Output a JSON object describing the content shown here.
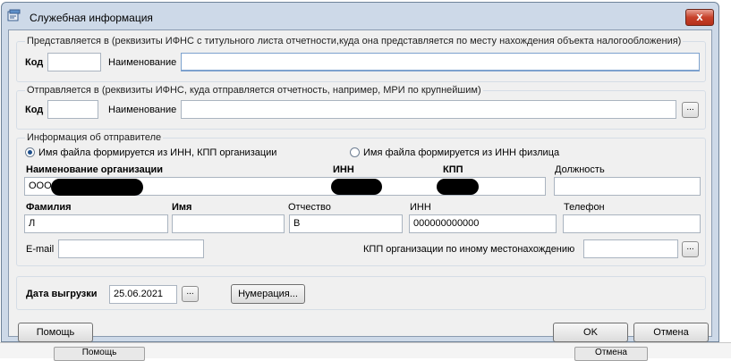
{
  "window": {
    "title": "Служебная информация",
    "close_label": "x"
  },
  "recipient": {
    "legend": "Представляется в (реквизиты ИФНС с титульного листа отчетности,куда она представляется по месту нахождения объекта налогообложения)",
    "code_label": "Код",
    "code_value": "",
    "name_label": "Наименование",
    "name_value": ""
  },
  "sent_to": {
    "legend": "Отправляется в (реквизиты ИФНС, куда отправляется отчетность, например, МРИ по крупнейшим)",
    "code_label": "Код",
    "code_value": "",
    "name_label": "Наименование",
    "name_value": "",
    "browse_label": "..."
  },
  "sender": {
    "legend": "Информация об отправителе",
    "radio_org": "Имя файла формируется из ИНН, КПП организации",
    "radio_person": "Имя файла формируется из ИНН физлица",
    "radio_selected": "org",
    "org_name_label": "Наименование организации",
    "org_name_value": "ООО",
    "inn_label": "ИНН",
    "kpp_label": "КПП",
    "position_label": "Должность",
    "position_value": "",
    "surname_label": "Фамилия",
    "surname_value": "Л",
    "name_label": "Имя",
    "name_value": "",
    "patronymic_label": "Отчество",
    "patronymic_value": "В",
    "inn2_label": "ИНН",
    "inn2_value": "000000000000",
    "phone_label": "Телефон",
    "phone_value": "",
    "email_label": "E-mail",
    "email_value": "",
    "kpp_other_label": "КПП организации по иному местонахождению",
    "kpp_other_value": "",
    "browse_label": "..."
  },
  "export": {
    "date_label": "Дата выгрузки",
    "date_value": "25.06.2021",
    "date_btn": "...",
    "numbering_btn": "Нумерация..."
  },
  "footer": {
    "help": "Помощь",
    "ok": "OK",
    "cancel": "Отмена"
  },
  "background": {
    "left_btn": "Помощь",
    "right_btn": "Отмена"
  },
  "colors": {
    "frame": "#cdd9e8",
    "client": "#f0f0f0",
    "close": "#c7412a",
    "accent": "#7da2ce"
  }
}
